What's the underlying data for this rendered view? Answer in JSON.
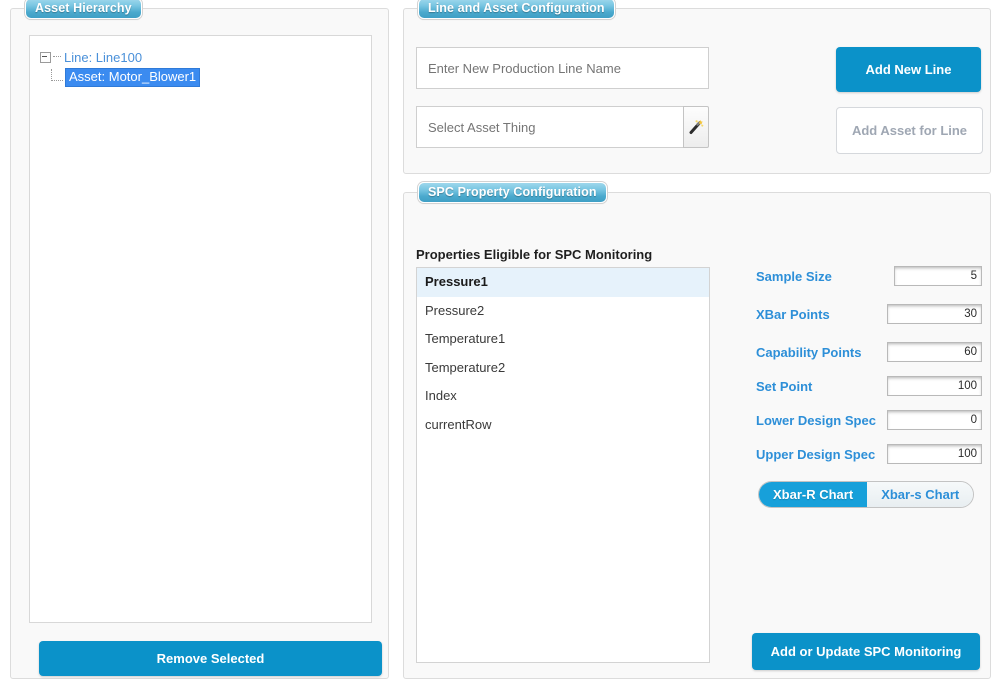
{
  "panels": {
    "hierarchy": {
      "title": "Asset Hierarchy"
    },
    "line_asset": {
      "title": "Line and Asset Configuration"
    },
    "spc": {
      "title": "SPC Property Configuration"
    }
  },
  "hierarchy": {
    "tree": {
      "root": {
        "label": "Line: Line100",
        "expanded": true,
        "toggle_icon": "minus-box-icon",
        "children": [
          {
            "label": "Asset: Motor_Blower1",
            "selected": true
          }
        ]
      }
    },
    "remove_button": "Remove Selected"
  },
  "line_asset": {
    "line_name_input": {
      "value": "",
      "placeholder": "Enter New Production Line Name"
    },
    "asset_thing_input": {
      "value": "",
      "placeholder": "Select Asset Thing"
    },
    "wand_button": {
      "icon": "magic-wand-icon",
      "label": ""
    },
    "add_new_line_button": "Add New Line",
    "add_asset_button": {
      "label": "Add Asset for Line",
      "disabled": true
    }
  },
  "spc": {
    "properties_caption": "Properties Eligible for SPC Monitoring",
    "properties": [
      {
        "label": "Pressure1",
        "selected": true
      },
      {
        "label": "Pressure2",
        "selected": false
      },
      {
        "label": "Temperature1",
        "selected": false
      },
      {
        "label": "Temperature2",
        "selected": false
      },
      {
        "label": "Index",
        "selected": false
      },
      {
        "label": "currentRow",
        "selected": false
      }
    ],
    "fields": [
      {
        "label": "Sample Size",
        "value": "5"
      },
      {
        "label": "XBar Points",
        "value": "30"
      },
      {
        "label": "Capability Points",
        "value": "60"
      },
      {
        "label": "Set Point",
        "value": "100"
      },
      {
        "label": "Lower Design Spec",
        "value": "0"
      },
      {
        "label": "Upper Design Spec",
        "value": "100"
      }
    ],
    "chart_toggle": {
      "options": [
        {
          "label": "Xbar-R Chart",
          "active": true
        },
        {
          "label": "Xbar-s Chart",
          "active": false
        }
      ]
    },
    "submit_button": "Add or Update SPC Monitoring"
  },
  "colors": {
    "accent_blue": "#0b92c9",
    "label_blue": "#2d8fd8",
    "toggle_active": "#17a0da",
    "selection_blue": "#3b8bf0",
    "row_selected_bg": "#e6f2fb",
    "panel_bg": "#f9f9f9",
    "panel_border": "#dcdcdc"
  }
}
